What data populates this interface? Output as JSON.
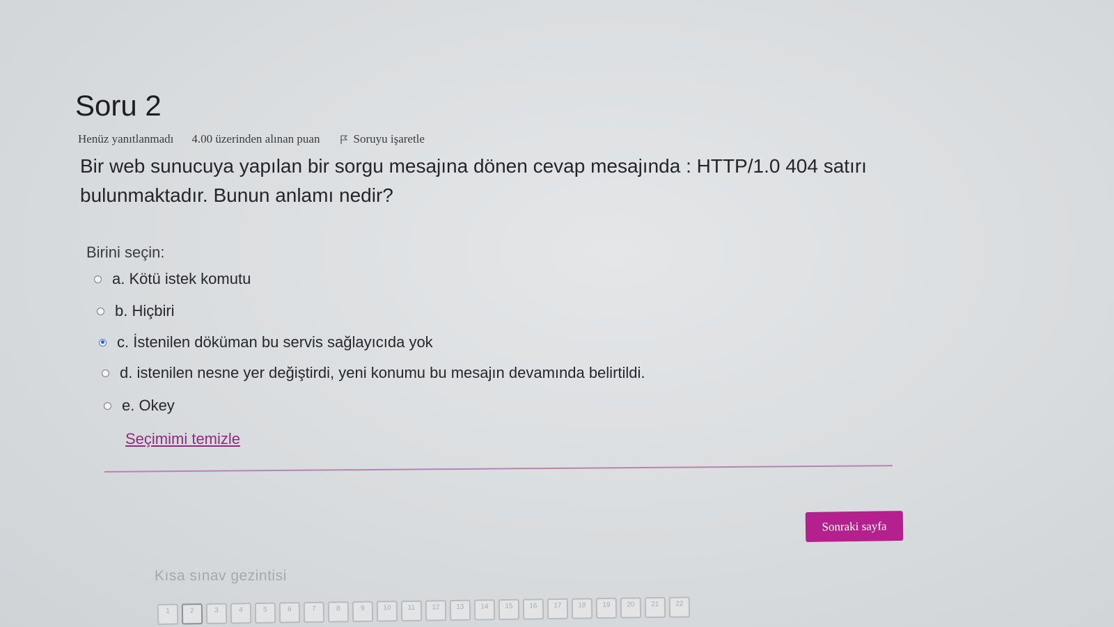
{
  "question": {
    "title": "Soru 2",
    "status": "Henüz yanıtlanmadı",
    "points": "4.00 üzerinden alınan puan",
    "flag_label": "Soruyu işaretle",
    "text": "Bir web sunucuya yapılan bir sorgu mesajına dönen cevap mesajında : HTTP/1.0 404 satırı bulunmaktadır. Bunun anlamı nedir?",
    "prompt": "Birini seçin:",
    "answers": [
      {
        "label": "a. Kötü istek komutu",
        "selected": false
      },
      {
        "label": "b. Hiçbiri",
        "selected": false
      },
      {
        "label": "c. İstenilen döküman bu servis sağlayıcıda yok",
        "selected": true
      },
      {
        "label": "d. istenilen nesne yer değiştirdi, yeni konumu bu mesajın devamında belirtildi.",
        "selected": false
      },
      {
        "label": "e. Okey",
        "selected": false
      }
    ],
    "clear_label": "Seçimimi temizle"
  },
  "footer": {
    "next_label": "Sonraki sayfa"
  },
  "quiz_nav": {
    "title": "Kısa sınav gezintisi",
    "current": "2",
    "pages": [
      "1",
      "2",
      "3",
      "4",
      "5",
      "6",
      "7",
      "8",
      "9",
      "10",
      "11",
      "12",
      "13",
      "14",
      "15",
      "16",
      "17",
      "18",
      "19",
      "20",
      "21",
      "22"
    ]
  },
  "colors": {
    "accent": "#b5208f",
    "link": "#8a2e7c",
    "selected_radio": "#2b5fc2"
  }
}
